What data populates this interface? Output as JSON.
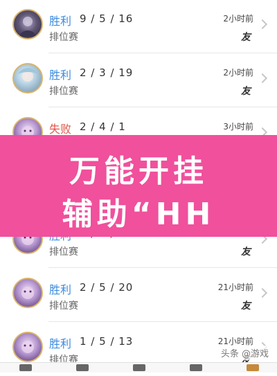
{
  "matches": [
    {
      "result": "胜利",
      "outcome": "win",
      "kda": "9 / 5 / 16",
      "mode": "排位赛",
      "time": "2小时前",
      "mark": "友"
    },
    {
      "result": "胜利",
      "outcome": "win",
      "kda": "2 / 3 / 19",
      "mode": "排位赛",
      "time": "2小时前",
      "mark": "友"
    },
    {
      "result": "失败",
      "outcome": "lose",
      "kda": "2 / 4 / 1",
      "mode": "",
      "time": "3小时前",
      "mark": ""
    },
    {
      "result": "胜利",
      "outcome": "win",
      "kda": "3 / 4 / 19",
      "mode": "排位赛",
      "time": "",
      "mark": "友"
    },
    {
      "result": "胜利",
      "outcome": "win",
      "kda": "2 / 5 / 20",
      "mode": "排位赛",
      "time": "21小时前",
      "mark": "友"
    },
    {
      "result": "胜利",
      "outcome": "win",
      "kda": "1 / 5 / 13",
      "mode": "排位赛",
      "time": "21小时前",
      "mark": "友"
    }
  ],
  "overlay": {
    "line1": "万能开挂",
    "line2": "辅助“HH"
  },
  "watermark": "头条 @游戏"
}
